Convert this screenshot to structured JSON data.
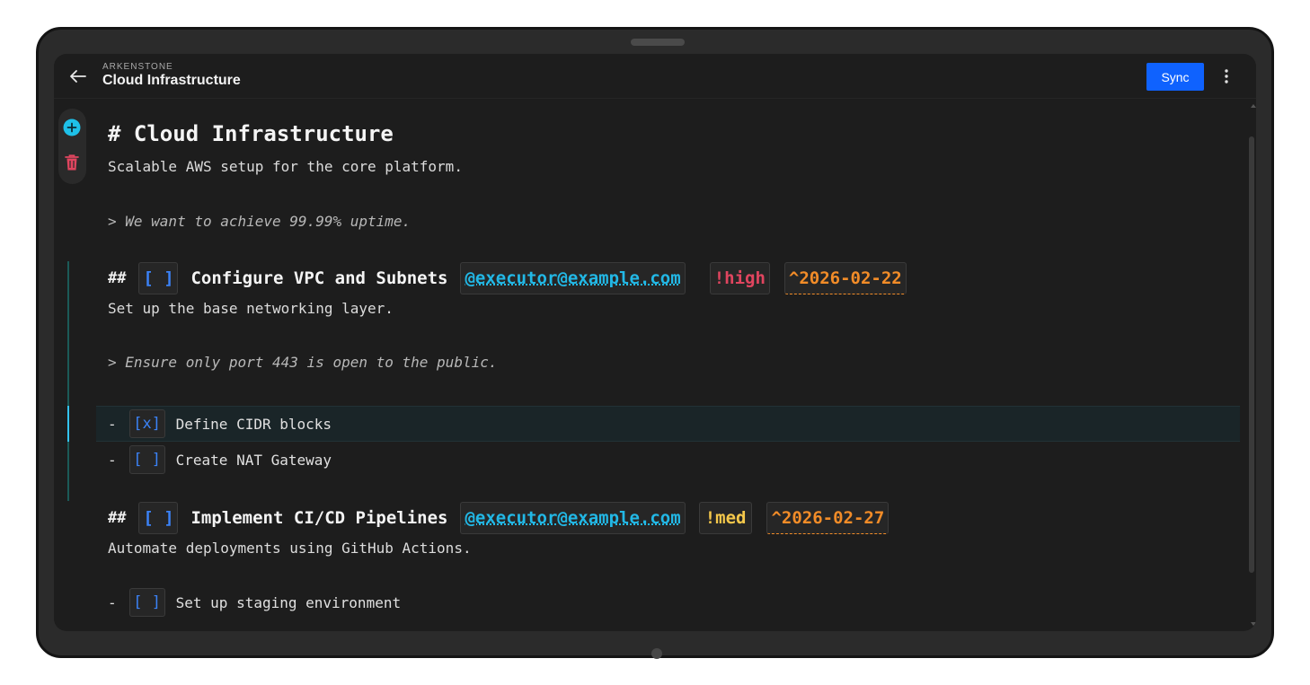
{
  "header": {
    "overline": "ARKENSTONE",
    "title": "Cloud Infrastructure",
    "sync_label": "Sync"
  },
  "icons": {
    "back": "arrow-left-icon",
    "more": "more-vertical-icon",
    "add": "add-circle-icon",
    "delete": "trash-icon"
  },
  "colors": {
    "accent_blue": "#0f62fe",
    "checkbox": "#3b82f6",
    "assignee": "#22b8e6",
    "priority_high": "#e0455f",
    "priority_med": "#f5c84b",
    "due_date": "#f28c28",
    "section_bar": "#1b5a58"
  },
  "document": {
    "h1": "# Cloud Infrastructure",
    "description": "Scalable AWS setup for the core platform.",
    "quote": "> We want to achieve 99.99% uptime.",
    "sections": [
      {
        "marker": "##",
        "checkbox": "[ ]",
        "title": "Configure VPC and Subnets",
        "assignee": "@executor@example.com",
        "priority": "!high",
        "due": "^2026-02-22",
        "description": "Set up the base networking layer.",
        "quote": "> Ensure only port 443 is open to the public.",
        "tasks": [
          {
            "dash": "-",
            "checkbox": "[x]",
            "label": "Define CIDR blocks"
          },
          {
            "dash": "-",
            "checkbox": "[ ]",
            "label": "Create NAT Gateway"
          }
        ]
      },
      {
        "marker": "##",
        "checkbox": "[ ]",
        "title": "Implement CI/CD Pipelines",
        "assignee": "@executor@example.com",
        "priority": "!med",
        "due": "^2026-02-27",
        "description": "Automate deployments using GitHub Actions.",
        "tasks": [
          {
            "dash": "-",
            "checkbox": "[ ]",
            "label": "Set up staging environment"
          }
        ]
      }
    ]
  }
}
